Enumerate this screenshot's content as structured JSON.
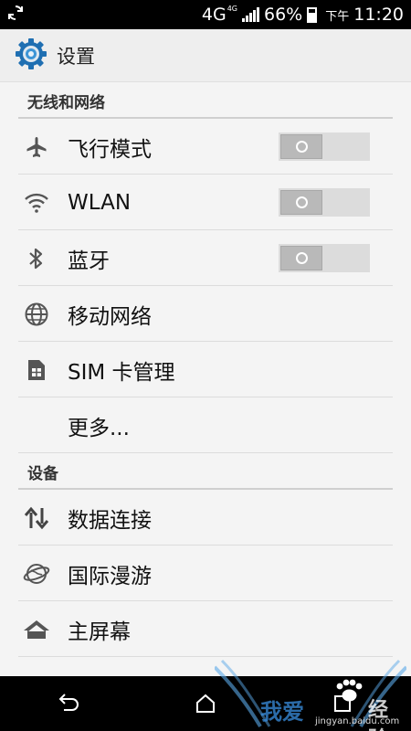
{
  "status_bar": {
    "network": "4G",
    "network_small": "4G",
    "battery_percent": "66%",
    "time_prefix": "下午",
    "time": "11:20"
  },
  "app_bar": {
    "title": "设置"
  },
  "sections": {
    "wireless": {
      "header": "无线和网络",
      "airplane": "飞行模式",
      "wlan": "WLAN",
      "bluetooth": "蓝牙",
      "mobile_network": "移动网络",
      "sim": "SIM 卡管理",
      "more": "更多..."
    },
    "device": {
      "header": "设备",
      "data_connection": "数据连接",
      "roaming": "国际漫游",
      "home_screen": "主屏幕"
    }
  },
  "toggles": {
    "airplane": "off",
    "wlan": "off",
    "bluetooth": "off"
  },
  "watermark": {
    "text": "我爱",
    "brand": "经验",
    "url": "jingyan.baidu.com"
  },
  "colors": {
    "status_bg": "#000000",
    "accent": "#2a7fc4",
    "divider": "#cfcfcf",
    "toggle_off": "#dcdcdc"
  }
}
